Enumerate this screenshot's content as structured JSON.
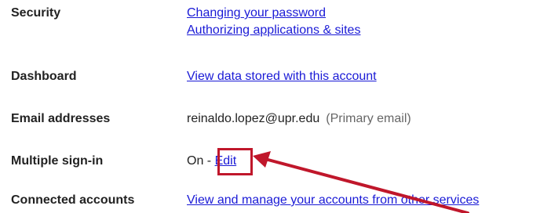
{
  "rows": [
    {
      "label": "Security",
      "links": [
        "Changing your password",
        "Authorizing applications & sites"
      ]
    },
    {
      "label": "Dashboard",
      "link": "View data stored with this account"
    },
    {
      "label": "Email addresses",
      "email": "reinaldo.lopez@upr.edu",
      "email_note": "(Primary email)"
    },
    {
      "label": "Multiple sign-in",
      "status": "On",
      "separator": "-",
      "edit_label": "Edit"
    },
    {
      "label": "Connected accounts",
      "link": "View and manage your accounts from other services"
    }
  ],
  "annotation": {
    "color": "#c0172b",
    "target": "Edit"
  }
}
